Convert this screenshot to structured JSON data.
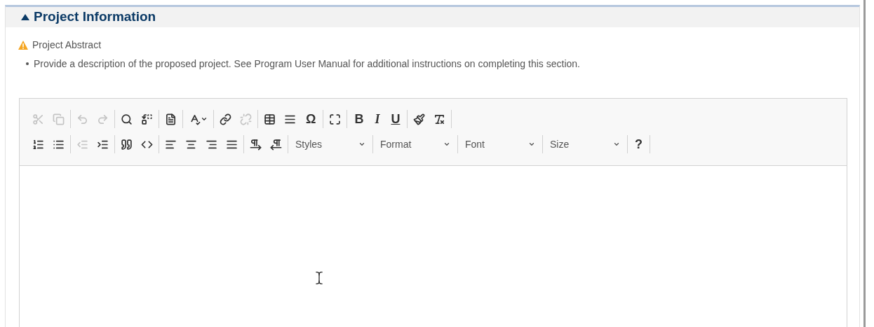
{
  "section": {
    "title": "Project Information",
    "expanded": true
  },
  "field": {
    "label": "Project Abstract",
    "required": true,
    "instructions": [
      "Provide a description of the proposed project. See Program User Manual for additional instructions on completing this section."
    ]
  },
  "toolbar": {
    "rows": [
      {
        "groups": [
          {
            "items": [
              {
                "kind": "icon",
                "disabled": true
              },
              {
                "kind": "icon",
                "disabled": true
              }
            ]
          },
          {
            "items": [
              {
                "kind": "icon",
                "disabled": true
              },
              {
                "kind": "icon",
                "disabled": true
              }
            ]
          },
          {
            "items": [
              {
                "kind": "icon",
                "disabled": false
              },
              {
                "kind": "icon",
                "disabled": false
              }
            ]
          },
          {
            "items": [
              {
                "kind": "icon",
                "disabled": false
              }
            ]
          },
          {
            "items": [
              {
                "kind": "icon-menu",
                "disabled": false
              }
            ]
          },
          {
            "items": [
              {
                "kind": "icon",
                "disabled": false
              },
              {
                "kind": "icon",
                "disabled": true
              }
            ]
          },
          {
            "items": [
              {
                "kind": "icon",
                "disabled": false
              },
              {
                "kind": "icon",
                "disabled": false
              },
              {
                "kind": "symbol",
                "label": "Ω",
                "disabled": false
              }
            ]
          },
          {
            "items": [
              {
                "kind": "icon",
                "disabled": false
              }
            ]
          },
          {
            "items": [
              {
                "kind": "bold",
                "label": "B",
                "disabled": false
              },
              {
                "kind": "italic",
                "label": "I",
                "disabled": false
              },
              {
                "kind": "underline",
                "label": "U",
                "disabled": false
              }
            ]
          },
          {
            "items": [
              {
                "kind": "icon",
                "disabled": false
              },
              {
                "kind": "icon",
                "disabled": false
              }
            ]
          }
        ]
      },
      {
        "groups": [
          {
            "items": [
              {
                "kind": "icon",
                "disabled": false
              },
              {
                "kind": "icon",
                "disabled": false
              }
            ]
          },
          {
            "items": [
              {
                "kind": "icon",
                "disabled": true
              },
              {
                "kind": "icon",
                "disabled": false
              }
            ]
          },
          {
            "items": [
              {
                "kind": "icon",
                "disabled": false
              },
              {
                "kind": "icon",
                "disabled": false
              }
            ]
          },
          {
            "items": [
              {
                "kind": "icon",
                "disabled": false
              },
              {
                "kind": "icon",
                "disabled": false
              },
              {
                "kind": "icon",
                "disabled": false
              },
              {
                "kind": "icon",
                "disabled": false
              }
            ]
          },
          {
            "items": [
              {
                "kind": "icon",
                "disabled": false
              },
              {
                "kind": "icon",
                "disabled": false
              }
            ]
          },
          {
            "items": [
              {
                "kind": "dropdown",
                "label": "Styles",
                "disabled": false
              }
            ]
          },
          {
            "items": [
              {
                "kind": "dropdown",
                "label": "Format",
                "disabled": false
              }
            ]
          },
          {
            "items": [
              {
                "kind": "dropdown",
                "label": "Font",
                "disabled": false
              }
            ]
          },
          {
            "items": [
              {
                "kind": "dropdown",
                "label": "Size",
                "disabled": false
              }
            ]
          },
          {
            "items": [
              {
                "kind": "symbol",
                "label": "?",
                "disabled": false
              }
            ]
          }
        ]
      }
    ]
  }
}
